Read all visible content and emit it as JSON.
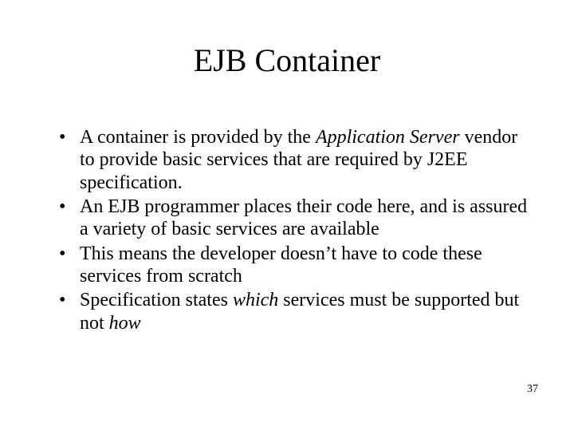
{
  "title": "EJB Container",
  "bullets": [
    {
      "pre": "A container is provided by the ",
      "em1": "Application Server",
      "mid": " vendor to provide basic services that are required by J2EE specification.",
      "em2": "",
      "post": ""
    },
    {
      "pre": "An EJB programmer places their code here, and is assured a variety of basic services are available",
      "em1": "",
      "mid": "",
      "em2": "",
      "post": ""
    },
    {
      "pre": "This means the developer doesn’t have to code these services from scratch",
      "em1": "",
      "mid": "",
      "em2": "",
      "post": ""
    },
    {
      "pre": "Specification states ",
      "em1": "which",
      "mid": " services must be supported but not ",
      "em2": "how",
      "post": ""
    }
  ],
  "bullet_char": "•",
  "page_number": "37"
}
